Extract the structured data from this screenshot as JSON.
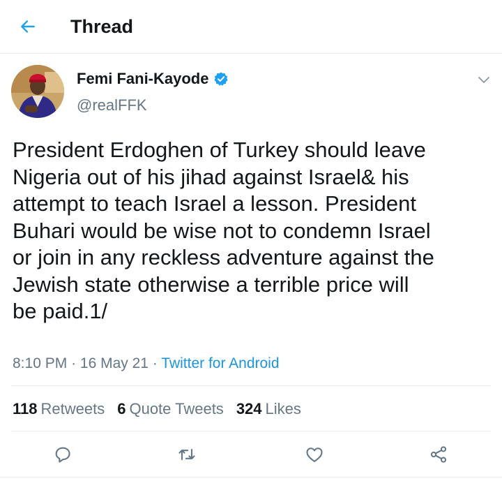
{
  "header": {
    "title": "Thread",
    "back_icon": "arrow-left-icon",
    "accent_color": "#1da1f2"
  },
  "tweet": {
    "author_name": "Femi Fani-Kayode",
    "handle": "@realFFK",
    "verified": true,
    "text": "President Erdoghen of Turkey should leave\nNigeria out of his jihad against Israel& his\nattempt to teach Israel a lesson.  President\nBuhari would be wise not to condemn Israel\nor join in any reckless adventure against the\nJewish state otherwise a terrible price will\nbe paid.1/",
    "time": "8:10 PM",
    "separator": "·",
    "date": "16 May 21",
    "source": "Twitter for Android",
    "source_color": "#1b95e0"
  },
  "stats": {
    "retweets_count": "118",
    "retweets_label": "Retweets",
    "quotes_count": "6",
    "quotes_label": "Quote Tweets",
    "likes_count": "324",
    "likes_label": "Likes"
  },
  "actions": {
    "reply_icon": "reply-icon",
    "retweet_icon": "retweet-icon",
    "like_icon": "heart-icon",
    "share_icon": "share-icon"
  }
}
